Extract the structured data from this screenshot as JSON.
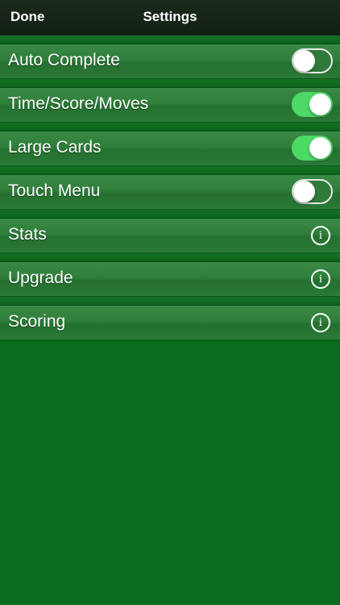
{
  "navbar": {
    "done_label": "Done",
    "title": "Settings"
  },
  "settings": {
    "auto_complete": {
      "label": "Auto Complete",
      "enabled": false
    },
    "time_score_moves": {
      "label": "Time/Score/Moves",
      "enabled": true
    },
    "large_cards": {
      "label": "Large Cards",
      "enabled": true
    },
    "touch_menu": {
      "label": "Touch Menu",
      "enabled": false
    },
    "stats": {
      "label": "Stats",
      "icon": "info-icon"
    },
    "upgrade": {
      "label": "Upgrade",
      "icon": "info-icon"
    },
    "scoring": {
      "label": "Scoring",
      "icon": "info-icon"
    }
  },
  "colors": {
    "background": "#0a6a1e",
    "toggle_on": "#4cd964",
    "navbar": "#142416"
  }
}
